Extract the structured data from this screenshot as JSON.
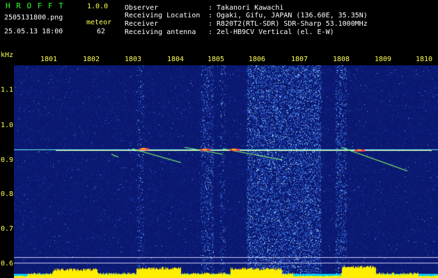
{
  "header": {
    "app_name": "H R O F F T",
    "app_version": "1.0.0",
    "filename": "2505131800.png",
    "mode_label": "meteor",
    "datetime": "25.05.13 18:00",
    "count": "62",
    "fields": [
      {
        "label": "Observer",
        "value": ": Takanori Kawachi"
      },
      {
        "label": "Receiving Location",
        "value": ": Ogaki, Gifu, JAPAN (136.60E, 35.35N)"
      },
      {
        "label": "Receiver",
        "value": ": R820T2(RTL-SDR) SDR-Sharp 53.1000MHz"
      },
      {
        "label": "Receiving antenna",
        "value": ": 2el-HB9CV Vertical (el. E-W)"
      }
    ]
  },
  "colors": {
    "header_green": "#33ff33",
    "header_yellow": "#ffff55",
    "header_white": "#ffffff",
    "tick_yellow": "#ffff55",
    "background_blue": "#0a1870",
    "bar_yellow": "#ffee00",
    "bar_cyan": "#00ccff"
  },
  "x_axis": {
    "ticks": [
      "1801",
      "1802",
      "1803",
      "1804",
      "1805",
      "1806",
      "1807",
      "1808",
      "1809",
      "1810"
    ]
  },
  "y_axis": {
    "unit": "kHz",
    "ticks": [
      "1.1",
      "1.0",
      "0.9",
      "0.8",
      "0.7",
      "0.6"
    ]
  }
}
